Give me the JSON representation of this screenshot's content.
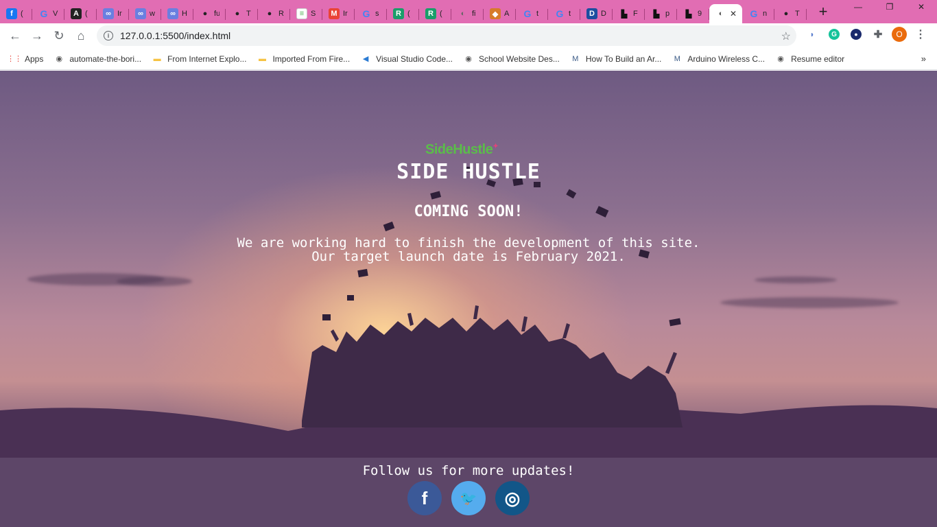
{
  "browser": {
    "tabs": [
      {
        "title": "(",
        "icon": "facebook-icon",
        "color": "#1877f2",
        "glyph": "f"
      },
      {
        "title": "V",
        "icon": "google-icon",
        "color": "#4285f4",
        "glyph": "G"
      },
      {
        "title": "(",
        "icon": "a-icon",
        "color": "#222222",
        "glyph": "A"
      },
      {
        "title": "Ir",
        "icon": "infinity-icon",
        "color": "#6a7fe0",
        "glyph": "∞"
      },
      {
        "title": "w",
        "icon": "infinity-icon",
        "color": "#6a7fe0",
        "glyph": "∞"
      },
      {
        "title": "H",
        "icon": "infinity-icon",
        "color": "#6a7fe0",
        "glyph": "∞"
      },
      {
        "title": "fu",
        "icon": "github-icon",
        "color": "#222222",
        "glyph": "●"
      },
      {
        "title": "T",
        "icon": "github-icon",
        "color": "#222222",
        "glyph": "●"
      },
      {
        "title": "R",
        "icon": "github-icon",
        "color": "#222222",
        "glyph": "●"
      },
      {
        "title": "S",
        "icon": "doc-icon",
        "color": "#ffffff",
        "glyph": "≡"
      },
      {
        "title": "Ir",
        "icon": "gmail-icon",
        "color": "#ea4335",
        "glyph": "M"
      },
      {
        "title": "s",
        "icon": "google-icon",
        "color": "#4285f4",
        "glyph": "G"
      },
      {
        "title": "(",
        "icon": "r-icon",
        "color": "#1a9e6a",
        "glyph": "R"
      },
      {
        "title": "(",
        "icon": "r-icon",
        "color": "#1a9e6a",
        "glyph": "R"
      },
      {
        "title": "fi",
        "icon": "globe-icon",
        "color": "#666666",
        "glyph": "◐"
      },
      {
        "title": "A",
        "icon": "puzzle-icon",
        "color": "#d77b2a",
        "glyph": "◆"
      },
      {
        "title": "t",
        "icon": "google-icon",
        "color": "#4285f4",
        "glyph": "G"
      },
      {
        "title": "t",
        "icon": "google-icon",
        "color": "#4285f4",
        "glyph": "G"
      },
      {
        "title": "D",
        "icon": "d-icon",
        "color": "#1c4ea0",
        "glyph": "D"
      },
      {
        "title": "F",
        "icon": "block-icon",
        "color": "#111111",
        "glyph": "▙"
      },
      {
        "title": "p",
        "icon": "block-icon",
        "color": "#111111",
        "glyph": "▙"
      },
      {
        "title": "9",
        "icon": "block-icon",
        "color": "#111111",
        "glyph": "▙"
      },
      {
        "title": "",
        "icon": "globe-icon",
        "color": "#555555",
        "glyph": "◐",
        "active": true
      },
      {
        "title": "n",
        "icon": "google-icon",
        "color": "#4285f4",
        "glyph": "G"
      },
      {
        "title": "T",
        "icon": "github-icon",
        "color": "#222222",
        "glyph": "●"
      }
    ],
    "url": "127.0.0.1:5500/index.html",
    "bookmarks": [
      {
        "label": "Apps",
        "icon": "apps-grid-icon"
      },
      {
        "label": "automate-the-bori...",
        "icon": "globe-icon"
      },
      {
        "label": "From Internet Explo...",
        "icon": "folder-icon"
      },
      {
        "label": "Imported From Fire...",
        "icon": "folder-icon"
      },
      {
        "label": "Visual Studio Code...",
        "icon": "vscode-icon"
      },
      {
        "label": "School Website Des...",
        "icon": "globe-icon"
      },
      {
        "label": "How To Build an Ar...",
        "icon": "m-icon"
      },
      {
        "label": "Arduino Wireless C...",
        "icon": "m-icon"
      },
      {
        "label": "Resume editor",
        "icon": "globe-icon"
      }
    ],
    "profile_initial": "O"
  },
  "site": {
    "logo": "SideHustle",
    "title": "SIDE HUSTLE",
    "coming_soon": "COMING SOON!",
    "message_line1": "We are working hard to finish the development of this site.",
    "message_line2": "Our target launch date is February 2021.",
    "follow": "Follow us for more updates!",
    "social": [
      {
        "name": "facebook",
        "glyph": "f",
        "color": "#3b5998"
      },
      {
        "name": "twitter",
        "glyph": "🐦",
        "color": "#55acee"
      },
      {
        "name": "instagram",
        "glyph": "◎",
        "color": "#125688"
      }
    ]
  }
}
